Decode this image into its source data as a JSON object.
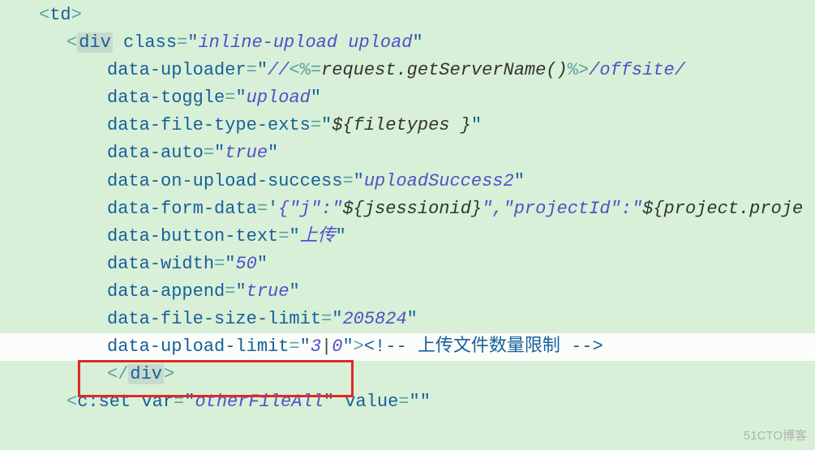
{
  "code": {
    "l0": {
      "lt": "<",
      "tag": "td",
      "gt": ">"
    },
    "l1": {
      "lt": "<",
      "tag": "div",
      "sp": " ",
      "a": "class",
      "eq": "=",
      "q": "\"",
      "v": "inline-upload upload",
      "q2": "\""
    },
    "l2": {
      "a": "data-uploader",
      "eq": "=",
      "q": "\"",
      "v1": "//",
      "scr1": "<%=",
      "mid": "request.getServerName()",
      "scr2": "%>",
      "v2": "/offsite/"
    },
    "l3": {
      "a": "data-toggle",
      "eq": "=",
      "q": "\"",
      "v": "upload",
      "q2": "\""
    },
    "l4": {
      "a": "data-file-type-exts",
      "eq": "=",
      "q": "\"",
      "e": "${filetypes }",
      "q2": "\""
    },
    "l5": {
      "a": "data-auto",
      "eq": "=",
      "q": "\"",
      "v": "true",
      "q2": "\""
    },
    "l6": {
      "a": "data-on-upload-success",
      "eq": "=",
      "q": "\"",
      "v": "uploadSuccess2",
      "q2": "\""
    },
    "l7": {
      "a": "data-form-data",
      "eq": "=",
      "q": "'",
      "v1": "{\"j\":\"",
      "e1": "${jsessionid}",
      "v2": "\",\"projectId\":\"",
      "e2": "${project.proje"
    },
    "l8": {
      "a": "data-button-text",
      "eq": "=",
      "q": "\"",
      "v": "上传",
      "q2": "\""
    },
    "l9": {
      "a": "data-width",
      "eq": "=",
      "q": "\"",
      "v": "50",
      "q2": "\""
    },
    "l10": {
      "a": "data-append",
      "eq": "=",
      "q": "\"",
      "v": "true",
      "q2": "\""
    },
    "l11": {
      "a": "data-file-size-limit",
      "eq": "=",
      "q": "\"",
      "v": "205824",
      "q2": "\""
    },
    "l12": {
      "a": "data-upload-limit",
      "eq": "=",
      "q": "\"",
      "v1": "3",
      "cursor": "|",
      "v2": "0",
      "q2": "\"",
      "gt": ">",
      "cm": "<!-- 上传文件数量限制 -->"
    },
    "l13": {
      "lt": "<",
      "sl": "/",
      "tag": "div",
      "gt": ">"
    },
    "l14": {
      "lt": "<",
      "tag": "c:set",
      "sp": " ",
      "a1": "var",
      "eq1": "=",
      "q1": "\"",
      "v1": "otherFileAll",
      "q1b": "\"",
      "sp2": " ",
      "a2": "value",
      "eq2": "=",
      "q2": "\"",
      "q2b": "\""
    }
  },
  "watermark": "51CTO博客"
}
